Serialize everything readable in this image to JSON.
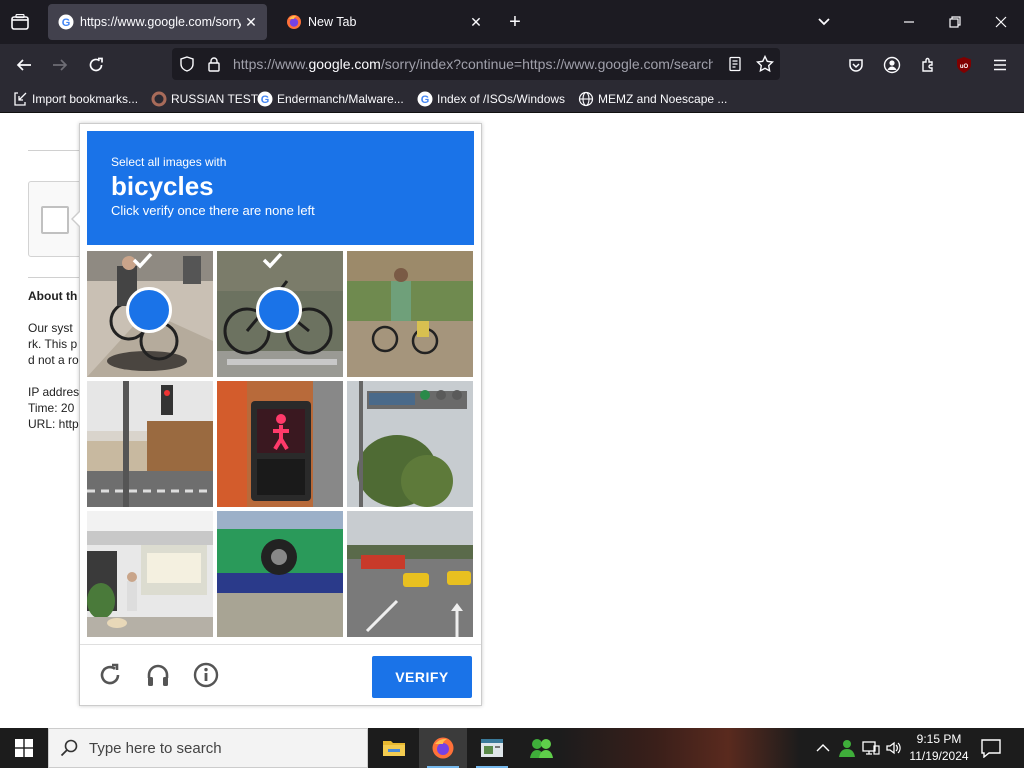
{
  "browser": {
    "tabs": [
      {
        "title": "https://www.google.com/sorry/index?continue=",
        "active": true
      },
      {
        "title": "New Tab",
        "active": false
      }
    ],
    "url": {
      "prefix": "https://www.",
      "domain": "google.com",
      "suffix": "/sorry/index?continue=https://www.google.com/search?q"
    },
    "bookmarks": [
      {
        "label": "Import bookmarks...",
        "icon": "import-icon"
      },
      {
        "label": "RUSSIAN TEST",
        "icon": "bookmark-favicon-icon"
      },
      {
        "label": "Endermanch/Malware...",
        "icon": "google-favicon-icon"
      },
      {
        "label": "Index of /ISOs/Windows",
        "icon": "google-favicon-icon"
      },
      {
        "label": "MEMZ and Noescape ...",
        "icon": "globe-icon"
      }
    ]
  },
  "page": {
    "about_heading": "About th",
    "lines": [
      "Our syst",
      "rk. This p",
      "d not a ro"
    ],
    "ip_label": "IP addres",
    "time_label": "Time: 20",
    "url_label": "URL: http"
  },
  "captcha": {
    "instruction": "Select all images with",
    "target": "bicycles",
    "subtext": "Click verify once there are none left",
    "verify_label": "VERIFY",
    "tiles": [
      {
        "content": "bicycle with rider",
        "selected": true
      },
      {
        "content": "bicycles on rack",
        "selected": true
      },
      {
        "content": "cyclists on road",
        "selected": false
      },
      {
        "content": "street with traffic light",
        "selected": false
      },
      {
        "content": "pedestrian signal",
        "selected": false
      },
      {
        "content": "traffic light and trees",
        "selected": false
      },
      {
        "content": "storefront with dog walker",
        "selected": false
      },
      {
        "content": "green bus wheel",
        "selected": false
      },
      {
        "content": "road with taxis",
        "selected": false
      }
    ]
  },
  "taskbar": {
    "search_placeholder": "Type here to search",
    "time": "9:15 PM",
    "date": "11/19/2024"
  },
  "colors": {
    "accent": "#1a73e8",
    "tab_bg": "#1c1b22",
    "toolbar_bg": "#2b2a33"
  }
}
